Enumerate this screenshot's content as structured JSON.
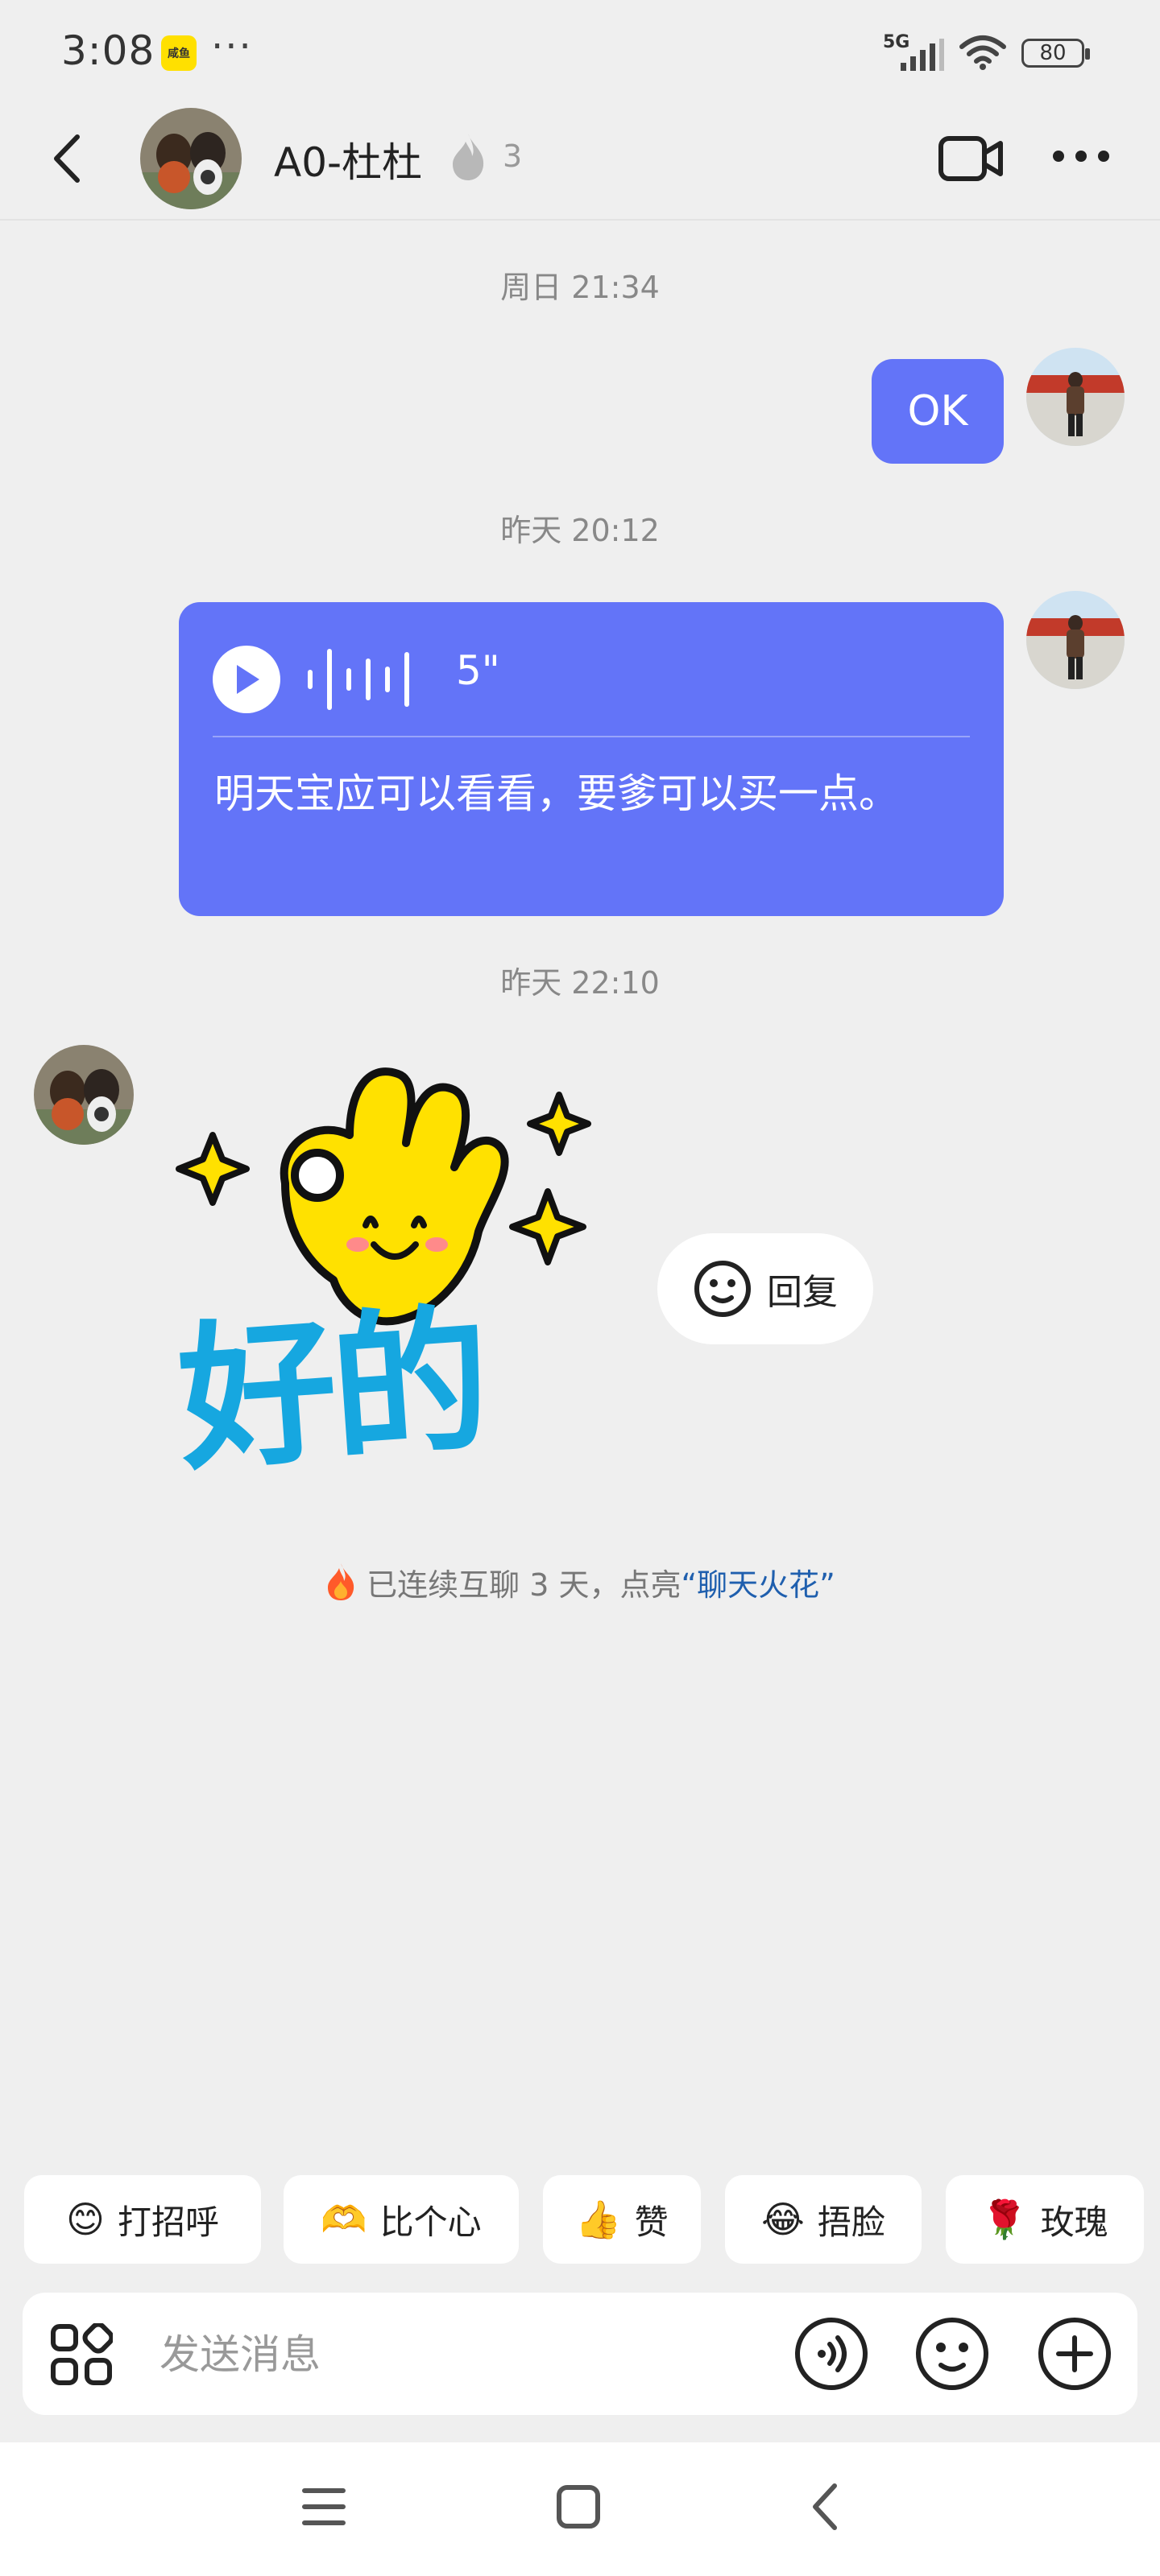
{
  "status_bar": {
    "time": "3:08",
    "app_notification": "咸鱼",
    "dots": "···",
    "network": "5G",
    "battery": "80"
  },
  "header": {
    "contact_name": "A0-杜杜",
    "streak_level": "3"
  },
  "messages": [
    {
      "timestamp": "周日 21:34",
      "sender": "self",
      "text": "OK"
    },
    {
      "timestamp": "昨天 20:12",
      "sender": "self",
      "type": "voice",
      "duration": "5\"",
      "transcript": "明天宝应可以看看，要爹可以买一点。"
    },
    {
      "timestamp": "昨天 22:10",
      "sender": "peer",
      "type": "sticker",
      "sticker_text": "好的"
    }
  ],
  "reply_chip": {
    "label": "回复"
  },
  "streak_notice": {
    "prefix": "已连续互聊 3 天，点亮",
    "link": "“聊天火花”"
  },
  "quick_replies": [
    {
      "label": "打招呼",
      "icon": "wave-emoji"
    },
    {
      "label": "比个心",
      "icon": "heart-hands-emoji"
    },
    {
      "label": "赞",
      "icon": "thumbs-up-emoji"
    },
    {
      "label": "捂脸",
      "icon": "facepalm-emoji"
    },
    {
      "label": "玫瑰",
      "icon": "rose-emoji"
    }
  ],
  "composer": {
    "placeholder": "发送消息"
  },
  "colors": {
    "accent_bubble": "#6374f8",
    "background": "#efefef",
    "link": "#1f5fae"
  }
}
